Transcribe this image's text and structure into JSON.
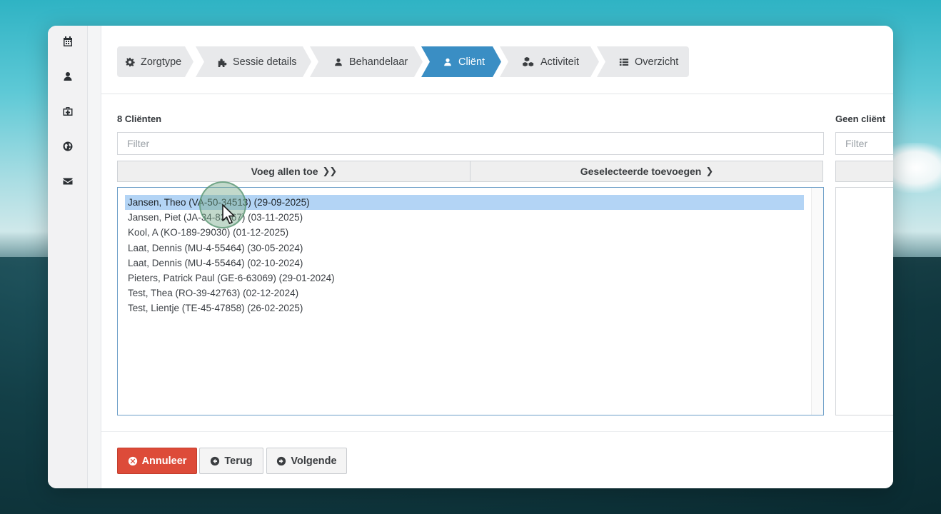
{
  "sidebar": {
    "icons": [
      "calendar-icon",
      "user-icon",
      "medkit-icon",
      "globe-icon",
      "envelope-icon"
    ]
  },
  "wizard": {
    "steps": [
      {
        "label": "Zorgtype",
        "icon": "gear-icon",
        "active": false
      },
      {
        "label": "Sessie details",
        "icon": "puzzle-icon",
        "active": false
      },
      {
        "label": "Behandelaar",
        "icon": "user-icon",
        "active": false
      },
      {
        "label": "Cliënt",
        "icon": "user-icon",
        "active": true
      },
      {
        "label": "Activiteit",
        "icon": "cubes-icon",
        "active": false
      },
      {
        "label": "Overzicht",
        "icon": "list-icon",
        "active": false
      }
    ]
  },
  "available": {
    "count_label": "8 Cliënten",
    "filter_placeholder": "Filter",
    "add_all_label": "Voeg allen toe",
    "add_all_chevron": "❯❯",
    "add_selected_label": "Geselecteerde toevoegen",
    "add_selected_chevron": "❯",
    "clients": [
      {
        "text": "Jansen, Theo (VA-50-34513) (29-09-2025)",
        "selected": true
      },
      {
        "text": "Jansen, Piet (JA-34-83367) (03-11-2025)",
        "selected": false
      },
      {
        "text": "Kool, A (KO-189-29030) (01-12-2025)",
        "selected": false
      },
      {
        "text": "Laat, Dennis (MU-4-55464) (30-05-2024)",
        "selected": false
      },
      {
        "text": "Laat, Dennis (MU-4-55464) (02-10-2024)",
        "selected": false
      },
      {
        "text": "Pieters, Patrick Paul (GE-6-63069) (29-01-2024)",
        "selected": false
      },
      {
        "text": "Test, Thea (RO-39-42763) (02-12-2024)",
        "selected": false
      },
      {
        "text": "Test, Lientje (TE-45-47858) (26-02-2025)",
        "selected": false
      }
    ]
  },
  "selected": {
    "count_label": "Geen cliënt",
    "filter_placeholder": "Filter"
  },
  "footer": {
    "cancel_label": "Annuleer",
    "back_label": "Terug",
    "next_label": "Volgende"
  },
  "colors": {
    "accent": "#3a8ec4",
    "danger": "#dd4b39",
    "selection": "#b3d4f5"
  }
}
